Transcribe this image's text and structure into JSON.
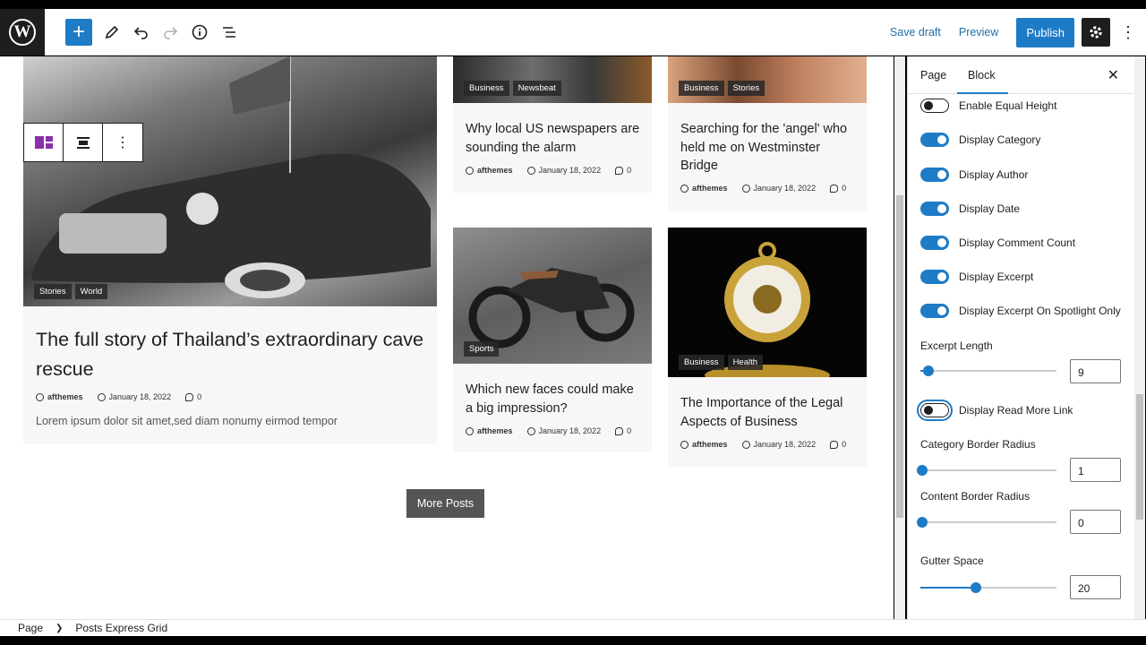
{
  "toolbar": {
    "logo_letter": "W",
    "save_draft": "Save draft",
    "preview": "Preview",
    "publish": "Publish"
  },
  "posts": [
    {
      "tags": [
        "Stories",
        "World"
      ],
      "title": "The full story of Thailand’s extraordinary cave rescue",
      "author": "afthemes",
      "date": "January 18, 2022",
      "comments": "0",
      "excerpt": "Lorem ipsum dolor sit amet,sed diam nonumy eirmod tempor"
    },
    {
      "tags": [
        "Business",
        "Newsbeat"
      ],
      "title": "Why local US newspapers are sounding the alarm",
      "author": "afthemes",
      "date": "January 18, 2022",
      "comments": "0"
    },
    {
      "tags": [
        "Business",
        "Stories"
      ],
      "title": "Searching for the 'angel' who held me on Westminster Bridge",
      "author": "afthemes",
      "date": "January 18, 2022",
      "comments": "0"
    },
    {
      "tags": [
        "Sports"
      ],
      "title": "Which new faces could make a big impression?",
      "author": "afthemes",
      "date": "January 18, 2022",
      "comments": "0"
    },
    {
      "tags": [
        "Business",
        "Health"
      ],
      "title": "The Importance of the Legal Aspects of Business",
      "author": "afthemes",
      "date": "January 18, 2022",
      "comments": "0"
    }
  ],
  "more_posts": "More Posts",
  "sidebar": {
    "tab_page": "Page",
    "tab_block": "Block",
    "toggles": [
      {
        "label": "Enable Equal Height",
        "on": false
      },
      {
        "label": "Display Category",
        "on": true
      },
      {
        "label": "Display Author",
        "on": true
      },
      {
        "label": "Display Date",
        "on": true
      },
      {
        "label": "Display Comment Count",
        "on": true
      },
      {
        "label": "Display Excerpt",
        "on": true
      },
      {
        "label": "Display Excerpt On Spotlight Only",
        "on": true
      }
    ],
    "excerpt_length": {
      "label": "Excerpt Length",
      "value": "9"
    },
    "read_more": {
      "label": "Display Read More Link",
      "on": false
    },
    "category_radius": {
      "label": "Category Border Radius",
      "value": "1"
    },
    "content_radius": {
      "label": "Content Border Radius",
      "value": "0"
    },
    "gutter": {
      "label": "Gutter Space",
      "value": "20"
    }
  },
  "breadcrumb": {
    "root": "Page",
    "current": "Posts Express Grid"
  }
}
